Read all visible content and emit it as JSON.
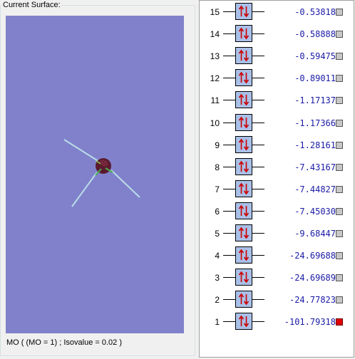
{
  "surface": {
    "legend": "Current Surface:",
    "status": "MO ( (MO = 1) ; Isovalue = 0.02 )"
  },
  "colors": {
    "viewport_background": "#8181cb",
    "orbital_box": "#a9c0e8",
    "electron_arrow": "#cc0000",
    "energy_text": "#1a1aa6",
    "selected_swatch": "#e00000",
    "unselected_swatch": "#c8c8c8"
  },
  "orbitals": [
    {
      "index": "15",
      "energy": "-0.53818",
      "occupancy": "paired",
      "selected": false
    },
    {
      "index": "14",
      "energy": "-0.58888",
      "occupancy": "paired",
      "selected": false
    },
    {
      "index": "13",
      "energy": "-0.59475",
      "occupancy": "paired",
      "selected": false
    },
    {
      "index": "12",
      "energy": "-0.89011",
      "occupancy": "paired",
      "selected": false
    },
    {
      "index": "11",
      "energy": "-1.17137",
      "occupancy": "paired",
      "selected": false
    },
    {
      "index": "10",
      "energy": "-1.17366",
      "occupancy": "paired",
      "selected": false
    },
    {
      "index": "9",
      "energy": "-1.28161",
      "occupancy": "paired",
      "selected": false
    },
    {
      "index": "8",
      "energy": "-7.43167",
      "occupancy": "paired",
      "selected": false
    },
    {
      "index": "7",
      "energy": "-7.44827",
      "occupancy": "paired",
      "selected": false
    },
    {
      "index": "6",
      "energy": "-7.45030",
      "occupancy": "paired",
      "selected": false
    },
    {
      "index": "5",
      "energy": "-9.68447",
      "occupancy": "paired",
      "selected": false
    },
    {
      "index": "4",
      "energy": "-24.69688",
      "occupancy": "paired",
      "selected": false
    },
    {
      "index": "3",
      "energy": "-24.69689",
      "occupancy": "paired",
      "selected": false
    },
    {
      "index": "2",
      "energy": "-24.77823",
      "occupancy": "paired",
      "selected": false
    },
    {
      "index": "1",
      "energy": "-101.79318",
      "occupancy": "paired",
      "selected": true
    }
  ]
}
